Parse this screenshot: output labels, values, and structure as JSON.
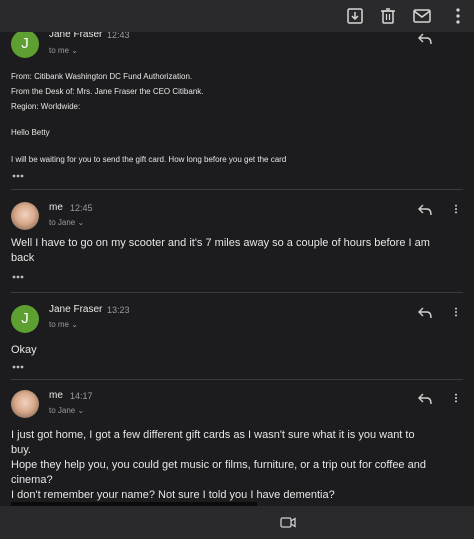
{
  "toolbar": {
    "archive_icon": "archive-icon",
    "delete_icon": "trash-icon",
    "mail_icon": "mail-icon"
  },
  "messages": [
    {
      "avatar_letter": "J",
      "sender": "Jane Fraser",
      "time": "12:43",
      "to": "to me",
      "body": [
        "From: Citibank Washington DC Fund Authorization.",
        "From the Desk of: Mrs. Jane Fraser the CEO Citibank.",
        "Region: Worldwide:",
        "Hello Betty",
        "I will be waiting for you to send the gift card. How long before you get the card"
      ]
    },
    {
      "sender": "me",
      "time": "12:45",
      "to": "to Jane",
      "body": [
        "Well I have to go on my scooter and it's 7 miles away so a couple of hours before I am",
        "back"
      ]
    },
    {
      "avatar_letter": "J",
      "sender": "Jane Fraser",
      "time": "13:23",
      "to": "to me",
      "body": [
        "Okay"
      ]
    },
    {
      "sender": "me",
      "time": "14:17",
      "to": "to Jane",
      "body": [
        "I just got home, I got a few different gift cards as I wasn't sure what it is you want to",
        "buy.",
        "Hope they help you, you could get music or films, furniture, or a trip out for coffee and",
        "cinema?",
        "I don't remember your name? Not sure I told you I have dementia?"
      ]
    }
  ],
  "bottom_bar": {
    "video_icon": "video-camera-icon"
  },
  "colors": {
    "background": "#1c1c1e",
    "bar": "#2a2a2c",
    "avatar_green": "#5e9f32",
    "divider": "#3a3a3c"
  }
}
